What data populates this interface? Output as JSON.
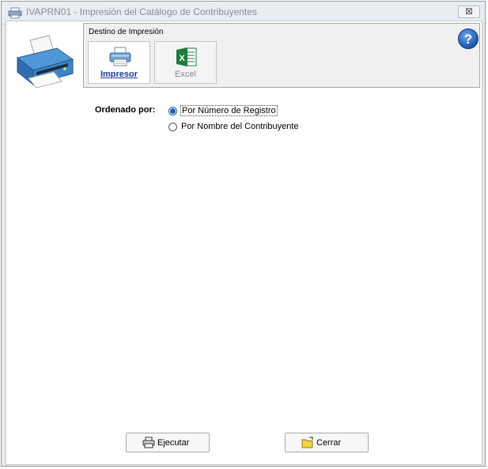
{
  "window": {
    "title": "IVAPRN01 - Impresión del Catálogo de Contribuyentes",
    "close_glyph": "⊠"
  },
  "destination": {
    "group_label": "Destino de Impresión",
    "options": [
      {
        "label": "Impresor",
        "icon": "printer-icon",
        "selected": true
      },
      {
        "label": "Excel",
        "icon": "excel-icon",
        "selected": false
      }
    ]
  },
  "order": {
    "label": "Ordenado por:",
    "options": [
      {
        "label": "Por Número de Registro",
        "checked": true
      },
      {
        "label": "Por Nombre del Contribuyente",
        "checked": false
      }
    ]
  },
  "actions": {
    "run_label": "Ejecutar",
    "close_label": "Cerrar"
  },
  "colors": {
    "accent": "#1b5fb0",
    "excel_green": "#1f7a3e"
  }
}
